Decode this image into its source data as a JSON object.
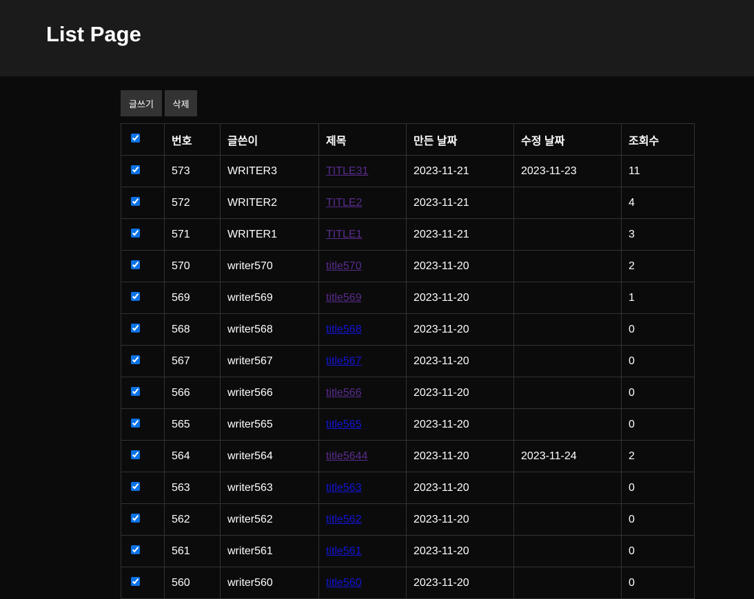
{
  "header": {
    "title": "List Page"
  },
  "toolbar": {
    "write_label": "글쓰기",
    "delete_label": "삭제"
  },
  "table": {
    "columns": [
      "번호",
      "글쓴이",
      "제목",
      "만든 날짜",
      "수정 날짜",
      "조회수"
    ],
    "rows": [
      {
        "no": "573",
        "writer": "WRITER3",
        "title": "TITLE31",
        "created": "2023-11-21",
        "modified": "2023-11-23",
        "views": "11",
        "visited": true
      },
      {
        "no": "572",
        "writer": "WRITER2",
        "title": "TITLE2",
        "created": "2023-11-21",
        "modified": "",
        "views": "4",
        "visited": true
      },
      {
        "no": "571",
        "writer": "WRITER1",
        "title": "TITLE1",
        "created": "2023-11-21",
        "modified": "",
        "views": "3",
        "visited": true
      },
      {
        "no": "570",
        "writer": "writer570",
        "title": "title570",
        "created": "2023-11-20",
        "modified": "",
        "views": "2",
        "visited": true
      },
      {
        "no": "569",
        "writer": "writer569",
        "title": "title569",
        "created": "2023-11-20",
        "modified": "",
        "views": "1",
        "visited": true
      },
      {
        "no": "568",
        "writer": "writer568",
        "title": "title568",
        "created": "2023-11-20",
        "modified": "",
        "views": "0",
        "visited": false
      },
      {
        "no": "567",
        "writer": "writer567",
        "title": "title567",
        "created": "2023-11-20",
        "modified": "",
        "views": "0",
        "visited": false
      },
      {
        "no": "566",
        "writer": "writer566",
        "title": "title566",
        "created": "2023-11-20",
        "modified": "",
        "views": "0",
        "visited": true
      },
      {
        "no": "565",
        "writer": "writer565",
        "title": "title565",
        "created": "2023-11-20",
        "modified": "",
        "views": "0",
        "visited": false
      },
      {
        "no": "564",
        "writer": "writer564",
        "title": "title5644",
        "created": "2023-11-20",
        "modified": "2023-11-24",
        "views": "2",
        "visited": true
      },
      {
        "no": "563",
        "writer": "writer563",
        "title": "title563",
        "created": "2023-11-20",
        "modified": "",
        "views": "0",
        "visited": false
      },
      {
        "no": "562",
        "writer": "writer562",
        "title": "title562",
        "created": "2023-11-20",
        "modified": "",
        "views": "0",
        "visited": false
      },
      {
        "no": "561",
        "writer": "writer561",
        "title": "title561",
        "created": "2023-11-20",
        "modified": "",
        "views": "0",
        "visited": false
      },
      {
        "no": "560",
        "writer": "writer560",
        "title": "title560",
        "created": "2023-11-20",
        "modified": "",
        "views": "0",
        "visited": false
      }
    ]
  },
  "colors": {
    "header_bg": "#1b1b1b",
    "page_bg": "#0b0b0b",
    "button_bg": "#333333",
    "visited_link": "#5a2c8f",
    "unvisited_link": "#1414d8",
    "checkbox_accent": "#0b73e8"
  }
}
